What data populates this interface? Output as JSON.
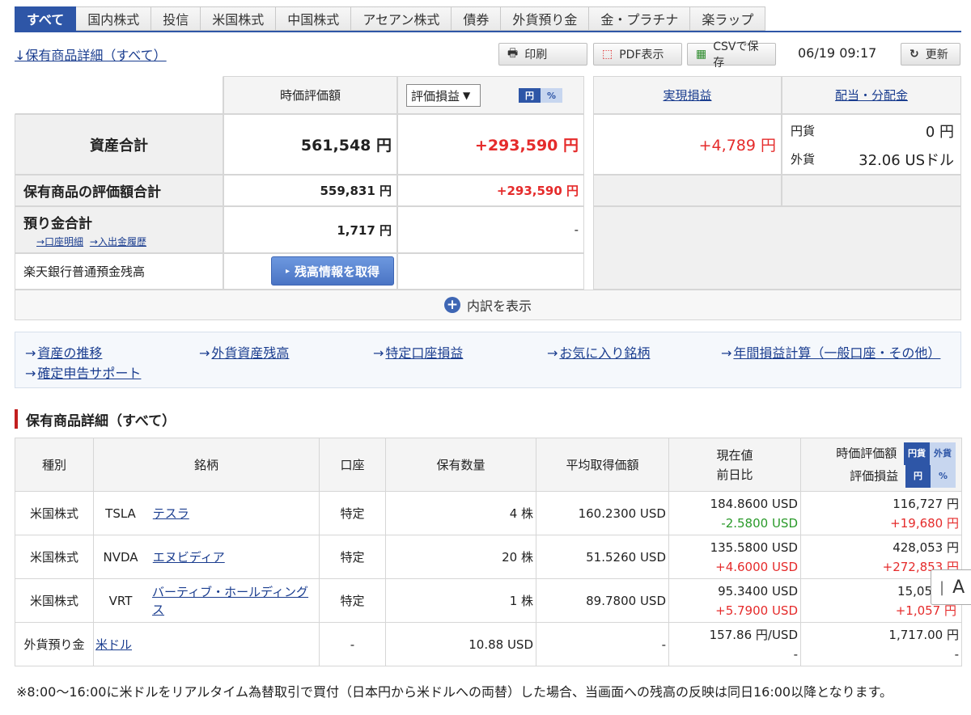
{
  "tabs": [
    {
      "label": "すべて",
      "active": true
    },
    {
      "label": "国内株式"
    },
    {
      "label": "投信"
    },
    {
      "label": "米国株式"
    },
    {
      "label": "中国株式"
    },
    {
      "label": "アセアン株式"
    },
    {
      "label": "債券"
    },
    {
      "label": "外貨預り金"
    },
    {
      "label": "金・プラチナ"
    },
    {
      "label": "楽ラップ"
    }
  ],
  "toolbar": {
    "title_link": "↓保有商品詳細（すべて）",
    "print": "印刷",
    "pdf": "PDF表示",
    "csv": "CSVで保存",
    "timestamp": "06/19 09:17",
    "refresh": "更新"
  },
  "summary": {
    "col_market_value": "時価評価額",
    "col_select": "評価損益",
    "toggle_yen": "円",
    "toggle_pct": "%",
    "col_realized": "実現損益",
    "col_dividend": "配当・分配金",
    "total_label": "資産合計",
    "total_value": "561,548 円",
    "total_pl": "+293,590 円",
    "realized_value": "+4,789 円",
    "div_yen_label": "円貨",
    "div_yen_value": "0 円",
    "div_fx_label": "外貨",
    "div_fx_value": "32.06 USドル",
    "holdings_label": "保有商品の評価額合計",
    "holdings_value": "559,831 円",
    "holdings_pl": "+293,590 円",
    "deposit_label": "預り金合計",
    "deposit_link1": "→口座明細",
    "deposit_link2": "→入出金履歴",
    "deposit_value": "1,717 円",
    "deposit_pl": "-",
    "bank_label": "楽天銀行普通預金残高",
    "bank_button": "残高情報を取得",
    "expand_label": "内訳を表示"
  },
  "quick_links": [
    "資産の推移",
    "外貨資産残高",
    "特定口座損益",
    "お気に入り銘柄",
    "年間損益計算（一般口座・その他）",
    "確定申告サポート"
  ],
  "section_title": "保有商品詳細（すべて）",
  "table": {
    "headers": {
      "type": "種別",
      "name": "銘柄",
      "account": "口座",
      "qty": "保有数量",
      "avg": "平均取得価額",
      "price1": "現在値",
      "price2": "前日比",
      "mv": "時価評価額",
      "mv_t1": "円貨",
      "mv_t2": "外貨",
      "pl": "評価損益",
      "pl_t1": "円",
      "pl_t2": "%"
    },
    "rows": [
      {
        "type": "米国株式",
        "ticker": "TSLA",
        "name": "テスラ",
        "account": "特定",
        "qty": "4 株",
        "avg": "160.2300 USD",
        "price": "184.8600 USD",
        "change": "-2.5800 USD",
        "mv": "116,727 円",
        "pl": "+19,680 円"
      },
      {
        "type": "米国株式",
        "ticker": "NVDA",
        "name": "エヌビディア",
        "account": "特定",
        "qty": "20 株",
        "avg": "51.5260 USD",
        "price": "135.5800 USD",
        "change": "+4.6000 USD",
        "mv": "428,053 円",
        "pl": "+272,853 円"
      },
      {
        "type": "米国株式",
        "ticker": "VRT",
        "name": "バーティブ・ホールディングス",
        "account": "特定",
        "qty": "1 株",
        "avg": "89.7800 USD",
        "price": "95.3400 USD",
        "change": "+5.7900 USD",
        "mv": "15,05",
        "pl": "+1,057 円"
      },
      {
        "type": "外貨預り金",
        "ticker": "",
        "name": "米ドル",
        "account": "-",
        "qty": "10.88 USD",
        "avg": "-",
        "price": "157.86 円/USD",
        "change": "-",
        "mv": "1,717.00 円",
        "pl": "-"
      }
    ]
  },
  "note": "※8:00～16:00に米ドルをリアルタイム為替取引で買付（日本円から米ドルへの両替）した場合、当画面への残高の反映は同日16:00以降となります。",
  "overlay_glyph": "A"
}
